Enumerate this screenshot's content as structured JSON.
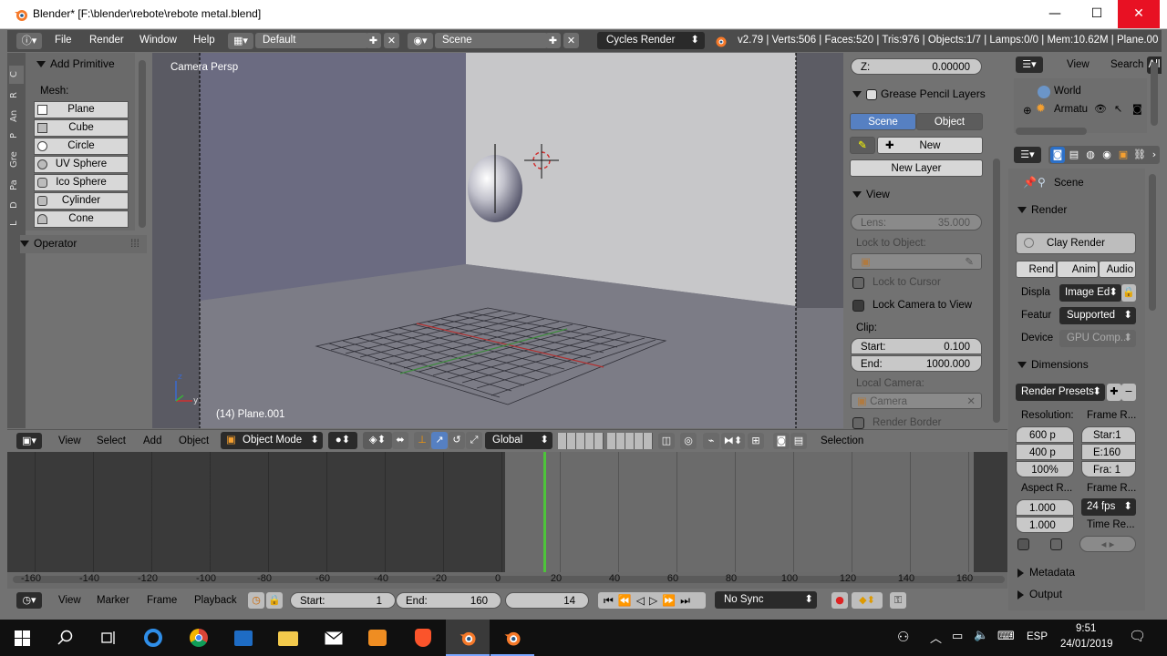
{
  "window": {
    "title": "Blender* [F:\\blender\\rebote\\rebote metal.blend]",
    "minimize": "—",
    "maximize": "☐",
    "close": "✕"
  },
  "top_header": {
    "menus": [
      "File",
      "Render",
      "Window",
      "Help"
    ],
    "layout": "Default",
    "scene": "Scene",
    "engine": "Cycles Render",
    "stats": "v2.79 | Verts:506 | Faces:520 | Tris:976 | Objects:1/7 | Lamps:0/0 | Mem:10.62M | Plane.00"
  },
  "tool_tabs": [
    "C",
    "R",
    "An",
    "P",
    "Gre",
    "Pa",
    "D",
    "L"
  ],
  "tool_panel": {
    "section_title": "Add Primitive",
    "mesh_label": "Mesh:",
    "items": [
      "Plane",
      "Cube",
      "Circle",
      "UV Sphere",
      "Ico Sphere",
      "Cylinder",
      "Cone"
    ],
    "operator_title": "Operator"
  },
  "viewport": {
    "label": "Camera Persp",
    "object_label": "(14) Plane.001"
  },
  "n_panel": {
    "z_label": "Z:",
    "z_value": "0.00000",
    "gp_title": "Grease Pencil Layers",
    "gp_tabs": [
      "Scene",
      "Object"
    ],
    "gp_new": "New",
    "gp_new_layer": "New Layer",
    "view_title": "View",
    "lens_label": "Lens:",
    "lens_value": "35.000",
    "lock_object_label": "Lock to Object:",
    "lock_cursor": "Lock to Cursor",
    "lock_camera": "Lock Camera to View",
    "clip_label": "Clip:",
    "clip_start_label": "Start:",
    "clip_start_value": "0.100",
    "clip_end_label": "End:",
    "clip_end_value": "1000.000",
    "local_camera_label": "Local Camera:",
    "local_camera_value": "Camera",
    "render_border": "Render Border"
  },
  "outliner": {
    "menus": [
      "View",
      "Search",
      "All"
    ],
    "items": [
      "World",
      "Armatu"
    ]
  },
  "properties": {
    "scene_label": "Scene",
    "render_title": "Render",
    "clay_render": "Clay Render",
    "render_buttons": [
      "Rend",
      "Anim",
      "Audio"
    ],
    "display_label": "Displa",
    "display_value": "Image Ed",
    "feature_label": "Featur",
    "feature_value": "Supported",
    "device_label": "Device",
    "device_value": "GPU Comp...",
    "dimensions_title": "Dimensions",
    "render_presets": "Render Presets",
    "resolution_label": "Resolution:",
    "frame_range_label": "Frame R...",
    "res_x": "600 p",
    "res_y": "400 p",
    "res_pct": "100%",
    "frame_start": "Star:1",
    "frame_end": "E:160",
    "frame_step": "Fra: 1",
    "aspect_label": "Aspect R...",
    "frame_rate_label": "Frame R...",
    "aspect_x": "1.000",
    "aspect_y": "1.000",
    "fps": "24 fps",
    "time_remap_label": "Time Re...",
    "metadata_title": "Metadata",
    "output_title": "Output"
  },
  "view_header": {
    "menus": [
      "View",
      "Select",
      "Add",
      "Object"
    ],
    "mode": "Object Mode",
    "orientation": "Global",
    "selection": "Selection"
  },
  "timeline": {
    "ruler": [
      "-160",
      "-140",
      "-120",
      "-100",
      "-80",
      "-60",
      "-40",
      "-20",
      "0",
      "20",
      "40",
      "60",
      "80",
      "100",
      "120",
      "140",
      "160"
    ],
    "current_frame": 14
  },
  "timeline_header": {
    "menus": [
      "View",
      "Marker",
      "Frame",
      "Playback"
    ],
    "start_label": "Start:",
    "start_value": "1",
    "end_label": "End:",
    "end_value": "160",
    "current_value": "14",
    "sync": "No Sync"
  },
  "taskbar": {
    "lang": "ESP",
    "time": "9:51",
    "date": "24/01/2019"
  },
  "colors": {
    "blender_header": "#4c4c4c",
    "panel_gray": "#727272",
    "active_blue": "#5680c2",
    "timeline_frame": "#4dc43a",
    "taskbar": "#101010"
  }
}
